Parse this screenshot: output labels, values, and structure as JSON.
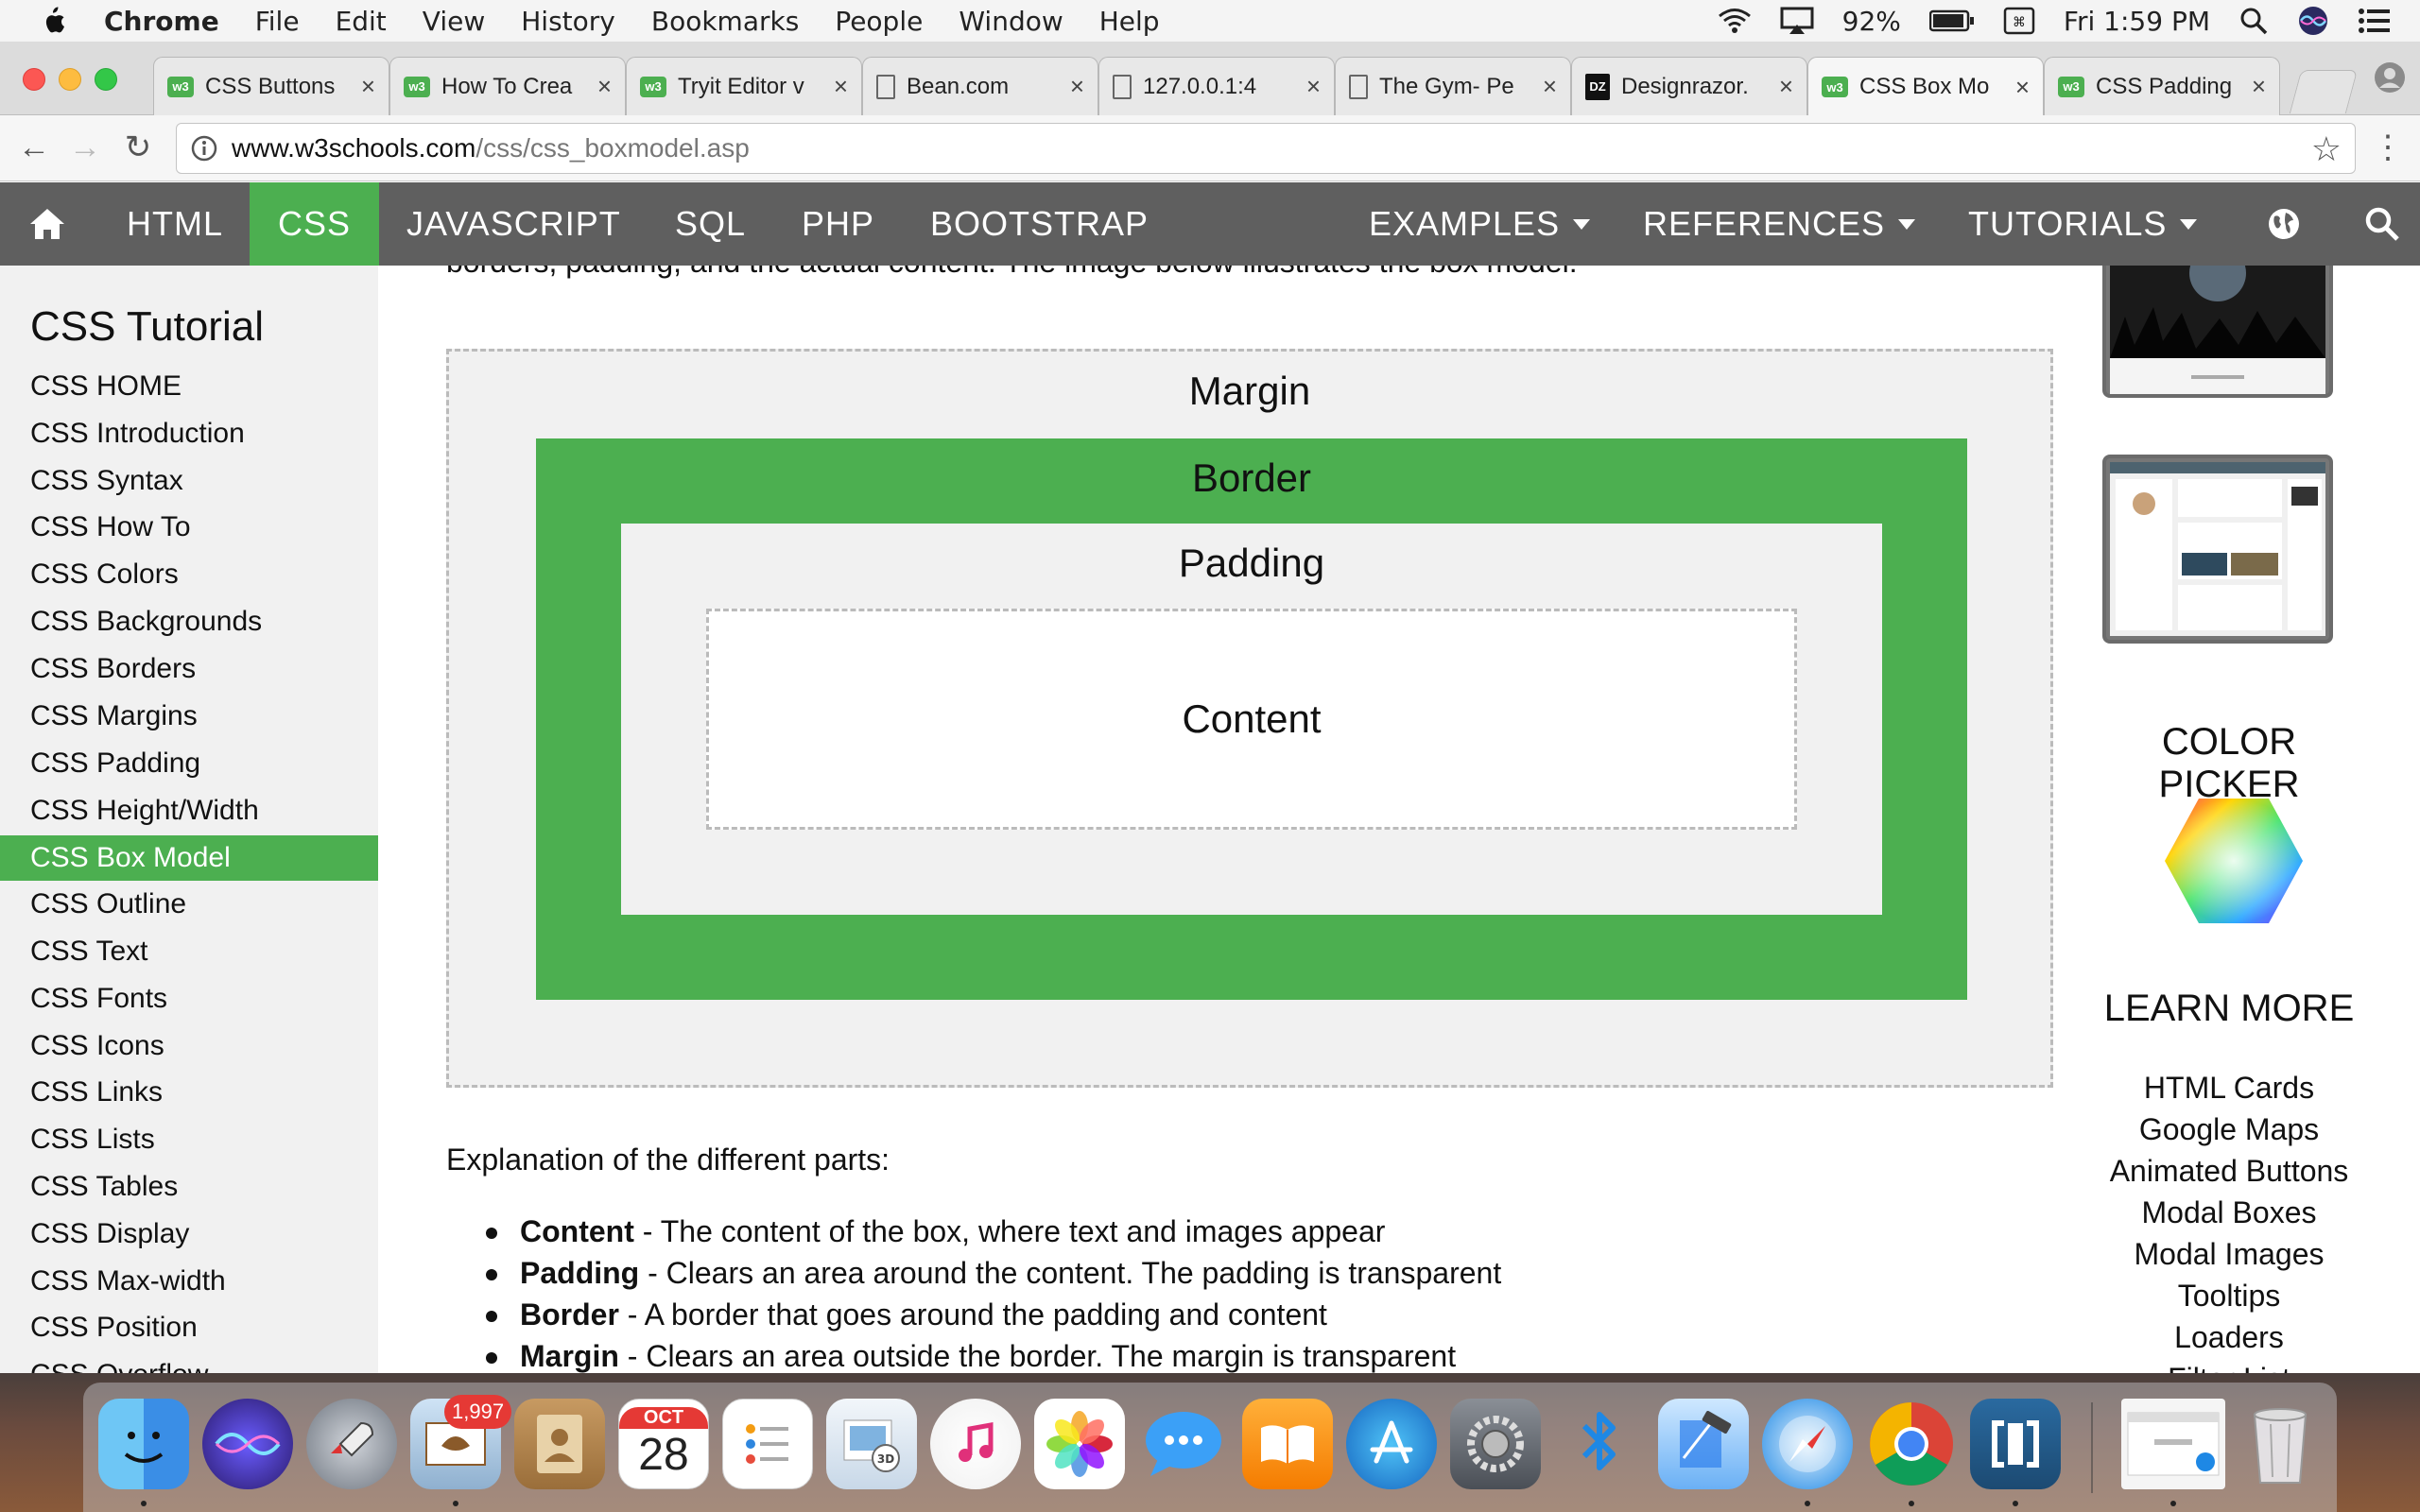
{
  "menubar": {
    "app": "Chrome",
    "items": [
      "File",
      "Edit",
      "View",
      "History",
      "Bookmarks",
      "People",
      "Window",
      "Help"
    ],
    "battery": "92%",
    "clock": "Fri 1:59 PM"
  },
  "tabs": [
    {
      "title": "CSS Buttons",
      "favicon": "w3schools-icon"
    },
    {
      "title": "How To Crea",
      "favicon": "w3schools-icon"
    },
    {
      "title": "Tryit Editor v",
      "favicon": "w3schools-icon"
    },
    {
      "title": "Bean.com",
      "favicon": "page-icon"
    },
    {
      "title": "127.0.0.1:4",
      "favicon": "page-icon"
    },
    {
      "title": "The Gym- Pe",
      "favicon": "page-icon"
    },
    {
      "title": "Designrazor.",
      "favicon": "designrazor-icon"
    },
    {
      "title": "CSS Box Mo",
      "favicon": "w3schools-icon",
      "active": true
    },
    {
      "title": "CSS Padding",
      "favicon": "w3schools-icon"
    }
  ],
  "address": {
    "host": "www.w3schools.com",
    "path": "/css/css_boxmodel.asp"
  },
  "topnav": {
    "items": [
      "HTML",
      "CSS",
      "JAVASCRIPT",
      "SQL",
      "PHP",
      "BOOTSTRAP"
    ],
    "right_items": [
      "EXAMPLES",
      "REFERENCES",
      "TUTORIALS"
    ],
    "active": "CSS"
  },
  "sidebar": {
    "title": "CSS Tutorial",
    "items": [
      "CSS HOME",
      "CSS Introduction",
      "CSS Syntax",
      "CSS How To",
      "CSS Colors",
      "CSS Backgrounds",
      "CSS Borders",
      "CSS Margins",
      "CSS Padding",
      "CSS Height/Width",
      "CSS Box Model",
      "CSS Outline",
      "CSS Text",
      "CSS Fonts",
      "CSS Icons",
      "CSS Links",
      "CSS Lists",
      "CSS Tables",
      "CSS Display",
      "CSS Max-width",
      "CSS Position",
      "CSS Overflow"
    ],
    "active": "CSS Box Model"
  },
  "main": {
    "intro": "borders, padding, and the actual content. The image below illustrates the box model:",
    "diagram": {
      "margin": "Margin",
      "border": "Border",
      "padding": "Padding",
      "content": "Content"
    },
    "explain": "Explanation of the different parts:",
    "bullets": [
      {
        "term": "Content",
        "text": " - The content of the box, where text and images appear"
      },
      {
        "term": "Padding",
        "text": " - Clears an area around the content. The padding is transparent"
      },
      {
        "term": "Border",
        "text": " - A border that goes around the padding and content"
      },
      {
        "term": "Margin",
        "text": " - Clears an area outside the border. The margin is transparent"
      }
    ]
  },
  "rightcol": {
    "color_picker": "COLOR PICKER",
    "learn_more": "LEARN MORE",
    "links": [
      "HTML Cards",
      "Google Maps",
      "Animated Buttons",
      "Modal Boxes",
      "Modal Images",
      "Tooltips",
      "Loaders",
      "Filter List"
    ]
  },
  "dock": {
    "mail_badge": "1,997",
    "calendar_month": "OCT",
    "calendar_day": "28",
    "icons": [
      "finder-icon",
      "siri-icon",
      "launchpad-icon",
      "mail-icon",
      "contacts-icon",
      "calendar-icon",
      "reminders-icon",
      "preview-icon",
      "itunes-icon",
      "photos-icon",
      "messages-icon",
      "ibooks-icon",
      "app-store-icon",
      "system-preferences-icon",
      "bluetooth-icon",
      "xcode-icon",
      "safari-icon",
      "chrome-icon",
      "brackets-icon",
      "window-preview-icon",
      "trash-icon"
    ]
  },
  "colors": {
    "w3_green": "#4caf50",
    "nav_gray": "#5f5f5f",
    "sidebar_bg": "#f1f1f1"
  }
}
